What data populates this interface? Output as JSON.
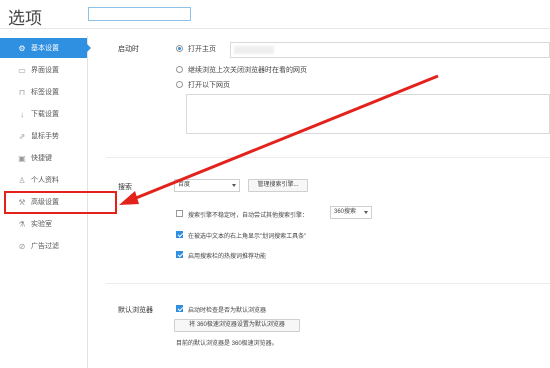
{
  "window": {
    "title": "选项"
  },
  "search": {
    "value": ""
  },
  "sidebar": {
    "items": [
      {
        "label": "基本设置",
        "icon": "gear-icon",
        "active": true
      },
      {
        "label": "界面设置",
        "icon": "window-icon"
      },
      {
        "label": "标签设置",
        "icon": "tab-icon"
      },
      {
        "label": "下载设置",
        "icon": "download-icon"
      },
      {
        "label": "鼠标手势",
        "icon": "mouse-icon"
      },
      {
        "label": "快捷键",
        "icon": "keyboard-icon"
      },
      {
        "label": "个人资料",
        "icon": "person-icon"
      },
      {
        "label": "高级设置",
        "icon": "wrench-icon"
      },
      {
        "label": "实验室",
        "icon": "lab-icon"
      },
      {
        "label": "广告过滤",
        "icon": "block-icon"
      }
    ]
  },
  "startup": {
    "label": "启动时",
    "options": [
      "打开主页",
      "继续浏览上次关闭浏览器时在看的网页",
      "打开以下网页"
    ],
    "selected": 0
  },
  "search_section": {
    "label": "搜索",
    "engine": "百度",
    "manage_button": "管理搜索引擎...",
    "fallback_text": "搜索引擎不稳定时，自动尝试其他搜索引擎：",
    "fallback_engine": "360搜索",
    "fallback_checked": false,
    "toolbar_text": "在被选中文本的右上角显示\"划词搜索工具条\"",
    "toolbar_checked": true,
    "hot_text": "启用搜索栏的热搜词推荐功能",
    "hot_checked": true
  },
  "default_browser": {
    "label": "默认浏览器",
    "check_text": "启动时检查是否为默认浏览器",
    "check_checked": true,
    "set_button": "将 360极速浏览器设置为默认浏览器",
    "status_text": "目前的默认浏览器是 360极速浏览器。"
  },
  "colors": {
    "accent": "#2f8fe0",
    "annotation": "#e3221c"
  }
}
